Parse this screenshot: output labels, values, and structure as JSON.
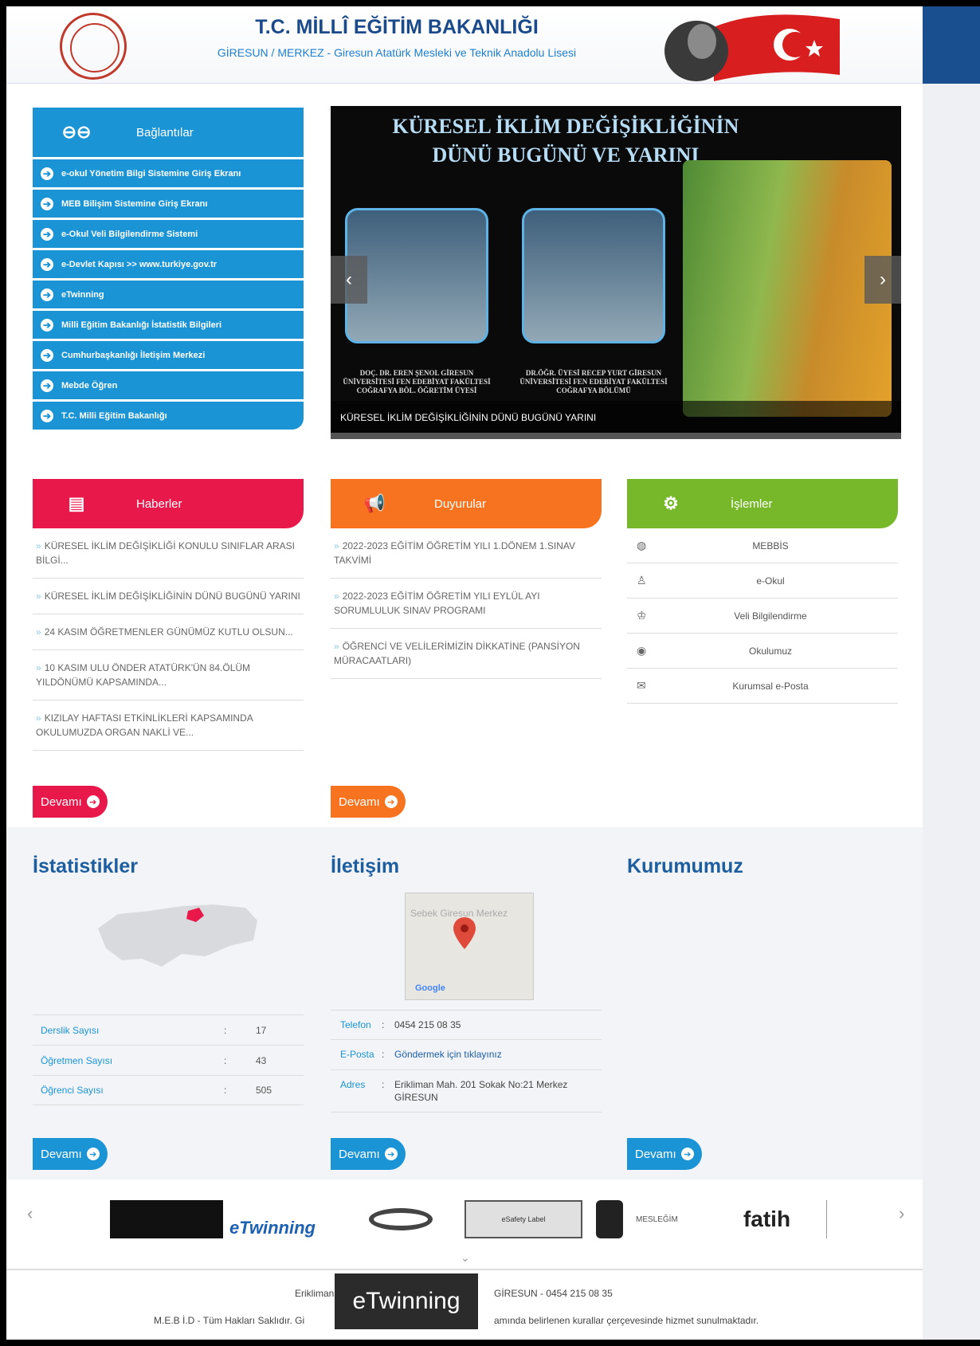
{
  "header": {
    "title": "T.C. MİLLÎ EĞİTİM BAKANLIĞI",
    "subtitle": "GİRESUN / MERKEZ - Giresun Atatürk Mesleki ve Teknik Anadolu Lisesi"
  },
  "links": {
    "heading": "Bağlantılar",
    "items": [
      "e-okul Yönetim Bilgi Sistemine Giriş Ekranı",
      "MEB Bilişim Sistemine Giriş Ekranı",
      "e-Okul Veli Bilgilendirme Sistemi",
      "e-Devlet Kapısı >> www.turkiye.gov.tr",
      "eTwinning",
      "Milli Eğitim Bakanlığı İstatistik Bilgileri",
      "Cumhurbaşkanlığı İletişim Merkezi",
      "Mebde Öğren",
      "T.C. Milli Eğitim Bakanlığı"
    ]
  },
  "slider": {
    "title_line1": "KÜRESEL İKLİM DEĞİŞİKLİĞİNİN",
    "title_line2": "DÜNÜ BUGÜNÜ VE  YARINI",
    "caption_left": "DOÇ. DR. EREN ŞENOL GİRESUN ÜNİVERSİTESİ FEN EDEBİYAT FAKÜLTESİ COĞRAFYA BÖL. ÖĞRETİM ÜYESİ",
    "caption_right": "DR.ÖĞR. ÜYESİ RECEP YURT GİRESUN ÜNİVERSİTESİ FEN EDEBİYAT FAKÜLTESİ COĞRAFYA BÖLÜMÜ",
    "slide_caption": "KÜRESEL İKLİM DEĞİŞİKLİĞİNİN DÜNÜ BUGÜNÜ YARINI",
    "prev": "‹",
    "next": "›"
  },
  "news": {
    "heading": "Haberler",
    "items": [
      "KÜRESEL İKLİM DEĞİŞİKLİĞİ KONULU SINIFLAR ARASI BİLGİ...",
      "KÜRESEL İKLİM DEĞİŞİKLİĞİNİN DÜNÜ BUGÜNÜ YARINI",
      "24 KASIM ÖĞRETMENLER GÜNÜMÜZ KUTLU OLSUN...",
      "10 KASIM ULU ÖNDER ATATÜRK'ÜN 84.ÖLÜM YILDÖNÜMÜ KAPSAMINDA...",
      "KIZILAY HAFTASI ETKİNLİKLERİ KAPSAMINDA OKULUMUZDA ORGAN NAKLİ VE..."
    ],
    "more": "Devamı"
  },
  "announcements": {
    "heading": "Duyurular",
    "items": [
      "2022-2023 EĞİTİM ÖĞRETİM YILI 1.DÖNEM 1.SINAV TAKVİMİ",
      "2022-2023 EĞİTİM ÖĞRETİM YILI EYLÜL AYI SORUMLULUK SINAV PROGRAMI",
      "ÖĞRENCİ VE VELİLERİMİZİN DİKKATİNE (PANSİYON MÜRACAATLARI)"
    ],
    "more": "Devamı"
  },
  "operations": {
    "heading": "İşlemler",
    "items": [
      "MEBBİS",
      "e-Okul",
      "Veli Bilgilendirme",
      "Okulumuz",
      "Kurumsal e-Posta"
    ]
  },
  "stats": {
    "heading": "İstatistikler",
    "rows": [
      {
        "k": "Derslik Sayısı",
        "v": "17"
      },
      {
        "k": "Öğretmen Sayısı",
        "v": "43"
      },
      {
        "k": "Öğrenci Sayısı",
        "v": "505"
      }
    ],
    "separator": ":",
    "more": "Devamı"
  },
  "contact": {
    "heading": "İletişim",
    "map_label": "Sebek Giresun Merkez",
    "map_brand": "Google",
    "rows": [
      {
        "k": "Telefon",
        "v": "0454 215 08 35"
      },
      {
        "k": "E-Posta",
        "v": "Göndermek için tıklayınız"
      },
      {
        "k": "Adres",
        "v": "Erikliman Mah. 201 Sokak No:21 Merkez GİRESUN"
      }
    ],
    "separator": ":",
    "more": "Devamı"
  },
  "institution": {
    "heading": "Kurumumuz",
    "more": "Devamı"
  },
  "partners": {
    "logos": [
      "eTwinning",
      "eSafety Label",
      "MESLEĞİM",
      "fatih"
    ],
    "prev": "‹",
    "next": "›"
  },
  "footer": {
    "line1_left": "Erikliman",
    "line1_right": "GİRESUN - 0454 215 08 35",
    "line2_left": "M.E.B İ.D - Tüm Hakları Saklıdır. Gi",
    "line2_right": "amında belirlenen kurallar çerçevesinde hizmet sunulmaktadır."
  },
  "tooltip": "eTwinning",
  "colors": {
    "blue": "#1b94d6",
    "red": "#e8184a",
    "orange": "#f7731f",
    "green": "#76b82a"
  }
}
